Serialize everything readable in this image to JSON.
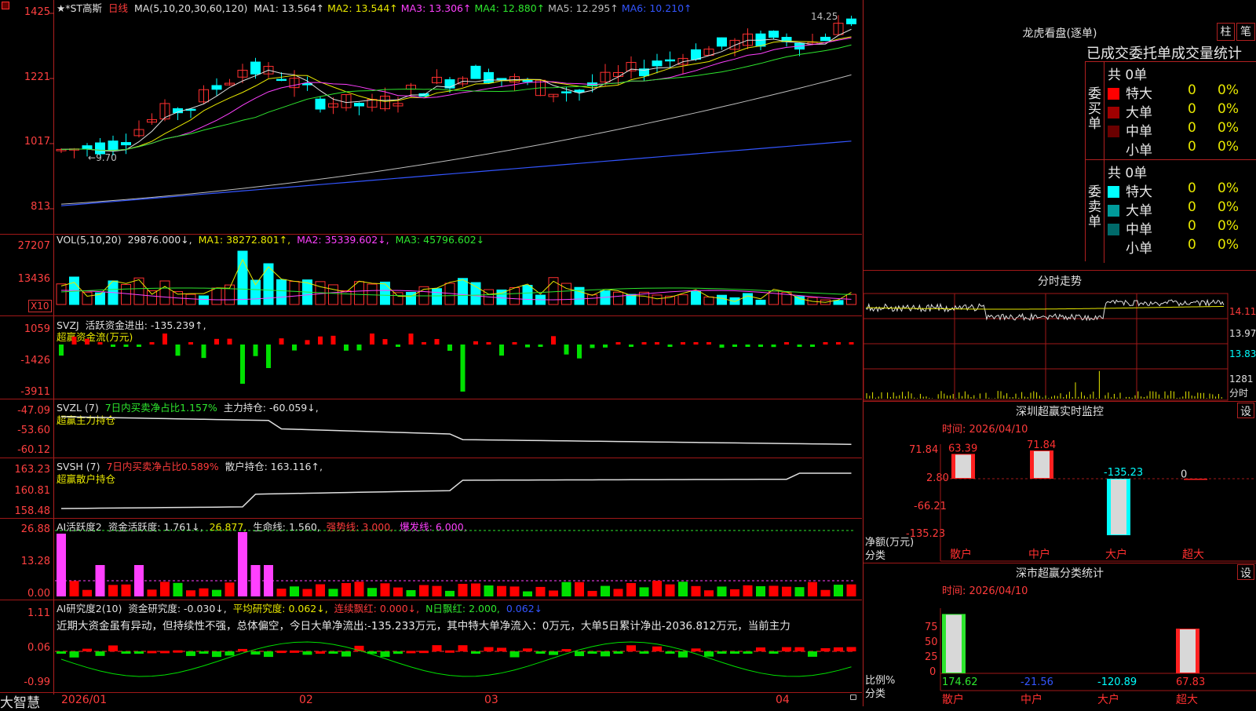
{
  "stock": {
    "title": "★*ST高斯",
    "period": "日线",
    "ma_params": "MA(5,10,20,30,60,120)",
    "ma_values": [
      {
        "label": "MA1:",
        "value": "13.564↑",
        "color": "#e0e0e0"
      },
      {
        "label": "MA2:",
        "value": "13.544↑",
        "color": "#e8e800"
      },
      {
        "label": "MA3:",
        "value": "13.306↑",
        "color": "#ff40ff"
      },
      {
        "label": "MA4:",
        "value": "12.880↑",
        "color": "#2ee62e"
      },
      {
        "label": "MA5:",
        "value": "12.295↑",
        "color": "#bdbdbd"
      },
      {
        "label": "MA6:",
        "value": "10.210↑",
        "color": "#3355ff"
      }
    ],
    "price_axis": [
      "1425",
      "1221",
      "1017",
      "813"
    ],
    "high_mark": "14.25",
    "low_mark": "9.70"
  },
  "vol": {
    "header": "VOL(5,10,20)",
    "value": "29876.000↓,",
    "ma1": "MA1: 38272.801↑,",
    "ma2": "MA2: 35339.602↓,",
    "ma3": "MA3: 45796.602↓",
    "axis": [
      "27207",
      "13436"
    ],
    "unit": "X10"
  },
  "svzj": {
    "header": "SVZJ",
    "text": "活跃资金进出: -135.239↑,",
    "sub": "超赢资金流(万元)",
    "axis": [
      "1059",
      "-1426",
      "-3911"
    ]
  },
  "svzl": {
    "header": "SVZL (7)",
    "ratio": "7日内买卖净占比1.157%",
    "value": "主力持仓: -60.059↓,",
    "sub": "超赢主力持仓",
    "axis": [
      "-47.09",
      "-53.60",
      "-60.12"
    ]
  },
  "svsh": {
    "header": "SVSH (7)",
    "ratio": "7日内买卖净占比0.589%",
    "value": "散户持仓: 163.116↑,",
    "sub": "超赢散户持仓",
    "axis": [
      "163.23",
      "160.81",
      "158.48"
    ]
  },
  "ai1": {
    "header": "AI活跃度2",
    "value": "资金活跃度: 1.761↓,",
    "v2": "26.877,",
    "life": "生命线: 1.560,",
    "strong": "强势线: 3.000,",
    "burst": "爆发线: 6.000,",
    "axis": [
      "26.88",
      "13.28",
      "0.00"
    ]
  },
  "ai2": {
    "header": "AI研究度2(10)",
    "value": "资金研究度: -0.030↓,",
    "avg": "平均研究度: 0.062↓,",
    "streak": "连续飘红: 0.000↓,",
    "nday": "N日飘红: 2.000,",
    "extra": "0.062↓",
    "comment": "近期大资金虽有异动，但持续性不强，总体偏空，今日大单净流出:-135.233万元，其中特大单净流入：0万元，大单5日累计净出-2036.812万元，当前主力",
    "axis": [
      "1.11",
      "0.06",
      "-0.99"
    ]
  },
  "time_axis": {
    "brand": "大智慧",
    "labels": [
      "2026/01",
      "02",
      "03",
      "04"
    ]
  },
  "right": {
    "dragon_title": "龙虎看盘(逐单)",
    "btn_bar": "柱",
    "btn_pen": "笔",
    "tabs_text": "已成交委托单成交量统计",
    "buy_label": "委买单",
    "sell_label": "委卖单",
    "buy_total": "共 0单",
    "sell_total": "共 0单",
    "buy_rows": [
      {
        "name": "特大",
        "count": "0",
        "pct": "0%",
        "color": "#ff0000"
      },
      {
        "name": "大单",
        "count": "0",
        "pct": "0%",
        "color": "#a00000"
      },
      {
        "name": "中单",
        "count": "0",
        "pct": "0%",
        "color": "#6a0000"
      },
      {
        "name": "小单",
        "count": "0",
        "pct": "0%",
        "color": ""
      }
    ],
    "sell_rows": [
      {
        "name": "特大",
        "count": "0",
        "pct": "0%",
        "color": "#00ffff"
      },
      {
        "name": "大单",
        "count": "0",
        "pct": "0%",
        "color": "#009a9a"
      },
      {
        "name": "中单",
        "count": "0",
        "pct": "0%",
        "color": "#006a6a"
      },
      {
        "name": "小单",
        "count": "0",
        "pct": "0%",
        "color": ""
      }
    ],
    "intraday_title": "分时走势",
    "intraday_axis": [
      "14.11",
      "13.97",
      "13.83"
    ],
    "intraday_vol": [
      "1281",
      "分时"
    ],
    "monitor_title": "深圳超赢实时监控",
    "monitor_btn": "设",
    "monitor_time": "时间: 2026/04/10",
    "monitor_axis": [
      "71.84",
      "2.80",
      "-66.21",
      "-135.23"
    ],
    "monitor_unit1": "净额(万元)",
    "monitor_unit2": "分类",
    "monitor_cats": [
      "散户",
      "中户",
      "大户",
      "超大"
    ],
    "monitor_values": [
      "63.39",
      "71.84",
      "-135.23",
      "0"
    ],
    "classify_title": "深市超赢分类统计",
    "classify_btn": "设",
    "classify_time": "时间: 2026/04/10",
    "classify_axis": [
      "75",
      "50",
      "25",
      "0"
    ],
    "classify_unit1": "比例%",
    "classify_unit2": "分类",
    "classify_cats": [
      "散户",
      "中户",
      "大户",
      "超大"
    ],
    "classify_values": [
      "174.62",
      "-21.56",
      "-120.89",
      "67.83"
    ]
  },
  "chart_data": [
    {
      "type": "candlestick",
      "title": "★*ST高斯 日线",
      "ylim": [
        8.13,
        14.25
      ],
      "note": "daily price (values shown as price*100 on axis)",
      "x": [
        "2026/01",
        "02",
        "03",
        "04"
      ],
      "ma_last": {
        "MA1": 13.564,
        "MA2": 13.544,
        "MA3": 13.306,
        "MA4": 12.88,
        "MA5": 12.295,
        "MA6": 10.21
      }
    },
    {
      "type": "bar",
      "title": "VOL(5,10,20)",
      "ylim": [
        0,
        27207
      ],
      "series": [
        {
          "name": "VOL",
          "last": 29876.0
        },
        {
          "name": "MA1",
          "last": 38272.801
        },
        {
          "name": "MA2",
          "last": 35339.602
        },
        {
          "name": "MA3",
          "last": 45796.602
        }
      ]
    },
    {
      "type": "bar",
      "title": "深圳超赢实时监控",
      "categories": [
        "散户",
        "中户",
        "大户",
        "超大"
      ],
      "values": [
        63.39,
        71.84,
        -135.23,
        0
      ],
      "ylim": [
        -135.23,
        71.84
      ]
    },
    {
      "type": "bar",
      "title": "深市超赢分类统计",
      "categories": [
        "散户",
        "中户",
        "大户",
        "超大"
      ],
      "values": [
        174.62,
        -21.56,
        -120.89,
        67.83
      ],
      "ylim": [
        0,
        75
      ]
    }
  ]
}
